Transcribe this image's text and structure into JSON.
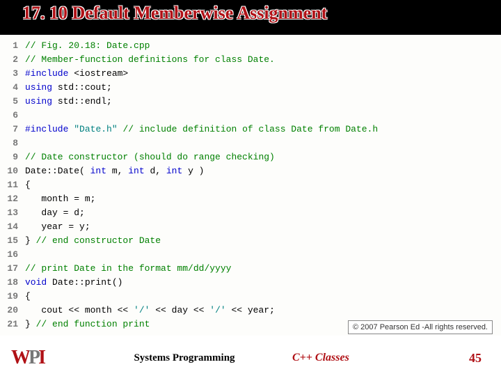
{
  "title": "17. 10 Default Memberwise Assignment",
  "code_lines": [
    {
      "n": "1",
      "html": "<span class='c-comment'>// Fig. 20.18: Date.cpp</span>"
    },
    {
      "n": "2",
      "html": "<span class='c-comment'>// Member-function definitions for class Date.</span>"
    },
    {
      "n": "3",
      "html": "<span class='c-pp'>#include</span> &lt;iostream&gt;"
    },
    {
      "n": "4",
      "html": "<span class='c-kw'>using</span> std::cout;"
    },
    {
      "n": "5",
      "html": "<span class='c-kw'>using</span> std::endl;"
    },
    {
      "n": "6",
      "html": ""
    },
    {
      "n": "7",
      "html": "<span class='c-pp'>#include</span> <span class='c-str'>\"Date.h\"</span> <span class='c-comment'>// include definition of class Date from Date.h</span>"
    },
    {
      "n": "8",
      "html": ""
    },
    {
      "n": "9",
      "html": "<span class='c-comment'>// Date constructor (should do range checking)</span>"
    },
    {
      "n": "10",
      "html": "Date::Date( <span class='c-kw'>int</span> m, <span class='c-kw'>int</span> d, <span class='c-kw'>int</span> y )"
    },
    {
      "n": "11",
      "html": "{"
    },
    {
      "n": "12",
      "html": "   month = m;"
    },
    {
      "n": "13",
      "html": "   day = d;"
    },
    {
      "n": "14",
      "html": "   year = y;"
    },
    {
      "n": "15",
      "html": "} <span class='c-comment'>// end constructor Date</span>"
    },
    {
      "n": "16",
      "html": ""
    },
    {
      "n": "17",
      "html": "<span class='c-comment'>// print Date in the format mm/dd/yyyy</span>"
    },
    {
      "n": "18",
      "html": "<span class='c-kw'>void</span> Date::print()"
    },
    {
      "n": "19",
      "html": "{"
    },
    {
      "n": "20",
      "html": "   cout &lt;&lt; month &lt;&lt; <span class='c-str'>'/'</span> &lt;&lt; day &lt;&lt; <span class='c-str'>'/'</span> &lt;&lt; year;"
    },
    {
      "n": "21",
      "html": "} <span class='c-comment'>// end function print</span>"
    }
  ],
  "copyright": "© 2007 Pearson Ed -All rights reserved.",
  "footer": {
    "logo": "WPI",
    "center": "Systems Programming",
    "topic": "C++ Classes",
    "page": "45"
  }
}
